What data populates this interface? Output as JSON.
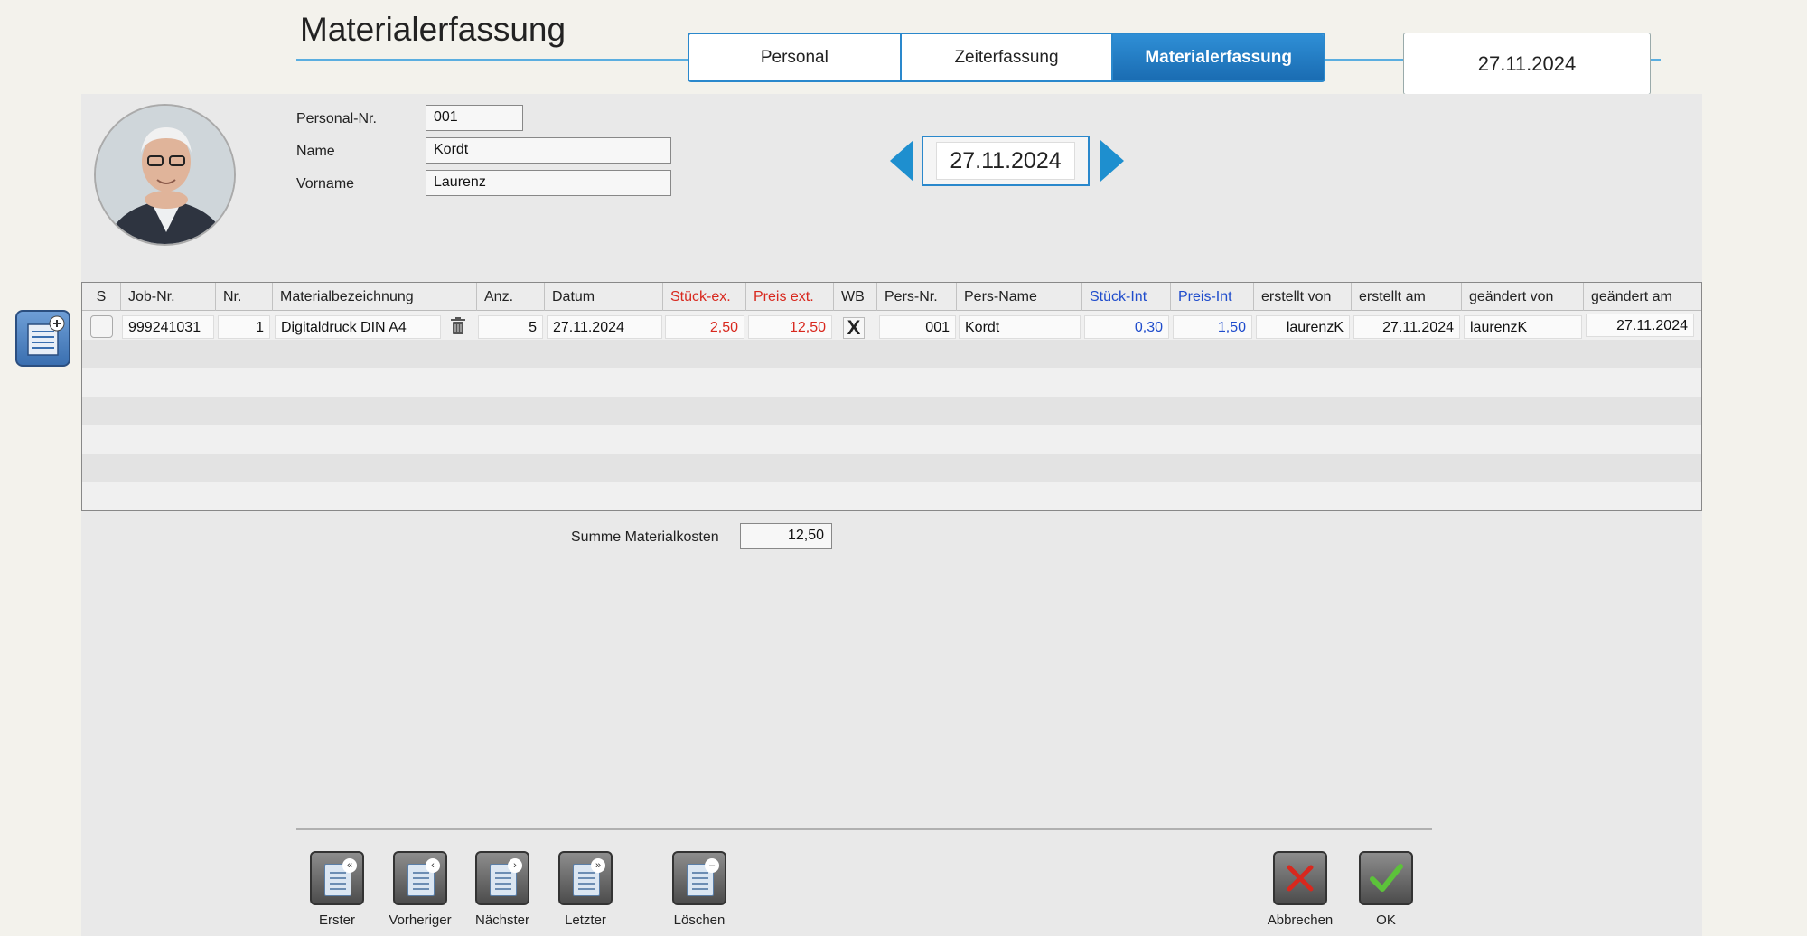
{
  "header": {
    "title": "Materialerfassung",
    "tabs": [
      {
        "label": "Personal",
        "active": false
      },
      {
        "label": "Zeiterfassung",
        "active": false
      },
      {
        "label": "Materialerfassung",
        "active": true
      }
    ],
    "date": "27.11.2024"
  },
  "person": {
    "personal_nr_label": "Personal-Nr.",
    "personal_nr": "001",
    "name_label": "Name",
    "name": "Kordt",
    "vorname_label": "Vorname",
    "vorname": "Laurenz"
  },
  "date_nav": {
    "date": "27.11.2024"
  },
  "table": {
    "columns": [
      "S",
      "Job-Nr.",
      "Nr.",
      "Materialbezeichnung",
      "Anz.",
      "Datum",
      "Stück-ex.",
      "Preis ext.",
      "WB",
      "Pers-Nr.",
      "Pers-Name",
      "Stück-Int",
      "Preis-Int",
      "erstellt von",
      "erstellt am",
      "geändert von",
      "geändert am"
    ],
    "rows": [
      {
        "job_nr": "999241031",
        "nr": "1",
        "material": "Digitaldruck DIN A4",
        "anz": "5",
        "datum": "27.11.2024",
        "stueck_ex": "2,50",
        "preis_ext": "12,50",
        "wb": "X",
        "pers_nr": "001",
        "pers_name": "Kordt",
        "stueck_int": "0,30",
        "preis_int": "1,50",
        "erstellt_von": "laurenzK",
        "erstellt_am": "27.11.2024",
        "geaendert_von": "laurenzK",
        "geaendert_am": "27.11.2024"
      }
    ]
  },
  "summary": {
    "label": "Summe Materialkosten",
    "value": "12,50"
  },
  "buttons": {
    "erster": "Erster",
    "vorheriger": "Vorheriger",
    "naechster": "Nächster",
    "letzter": "Letzter",
    "loeschen": "Löschen",
    "abbrechen": "Abbrechen",
    "ok": "OK"
  },
  "colors": {
    "accent": "#1e8fcf",
    "external_price": "#d8281e",
    "internal_price": "#1f4ccc"
  }
}
